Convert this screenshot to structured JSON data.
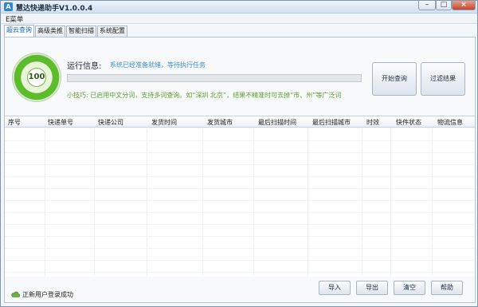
{
  "window": {
    "title": "慧达快递助手V1.0.0.4",
    "icon": "app-logo-icon",
    "controls": [
      "minimize-icon",
      "maximize-icon",
      "close-icon"
    ]
  },
  "menu": {
    "items": [
      "E菜单"
    ]
  },
  "tabs": [
    {
      "label": "超云查询",
      "active": true
    },
    {
      "label": "高级类推",
      "active": false
    },
    {
      "label": "智能扫描",
      "active": false
    },
    {
      "label": "系统配置",
      "active": false
    }
  ],
  "status_panel": {
    "gauge_value": "100",
    "run_label": "运行信息:",
    "run_text": "系统已经准备就绪，等待执行任务",
    "progress_value": 0.0,
    "tip": "小技巧: 已启用中文分词，支持多词查询。如“深圳 北京”，结果不精准时可去掉“市、州”等广泛词"
  },
  "actions": {
    "start": "开始查询",
    "filter": "过滤结果"
  },
  "table": {
    "columns": [
      "序号",
      "快递单号",
      "快递公司",
      "发货时间",
      "发货城市",
      "最后扫描时间",
      "最后扫描城市",
      "时效",
      "快件状态",
      "物流信息"
    ],
    "rows": []
  },
  "statusbar": {
    "text": "正新用户登录成功",
    "icon": "cloud-icon"
  },
  "bottom_buttons": [
    "导入",
    "导出",
    "清空",
    "帮助"
  ],
  "colors": {
    "accent": "#3b8ed4",
    "tip_green": "#5aa32e",
    "gauge_green": "#5cbc2c"
  }
}
